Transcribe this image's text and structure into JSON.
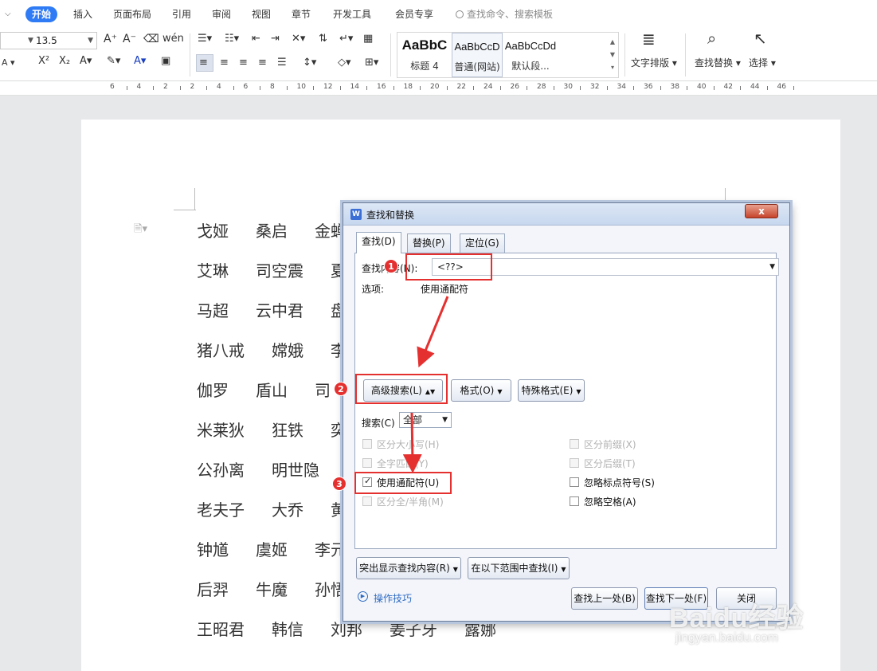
{
  "menubar": {
    "tabs": [
      "开始",
      "插入",
      "页面布局",
      "引用",
      "审阅",
      "视图",
      "章节",
      "开发工具",
      "会员专享"
    ],
    "search_placeholder": "查找命令、搜索模板"
  },
  "ribbon": {
    "font_size": "13.5",
    "styles": [
      {
        "sample": "AaBbC",
        "label": "标题 4"
      },
      {
        "sample": "AaBbCcD",
        "label": "普通(网站)"
      },
      {
        "sample": "AaBbCcDd",
        "label": "默认段..."
      }
    ],
    "text_layout_label": "文字排版",
    "find_replace_label": "查找替换",
    "select_label": "选择"
  },
  "ruler": {
    "labels": [
      "6",
      "4",
      "2",
      "2",
      "4",
      "6",
      "8",
      "10",
      "12",
      "14",
      "16",
      "18",
      "20",
      "22",
      "24",
      "26",
      "28",
      "30",
      "32",
      "34",
      "36",
      "38",
      "40",
      "42",
      "44",
      "46"
    ]
  },
  "document": {
    "rows": [
      [
        "戈娅",
        "桑启",
        "金蝉"
      ],
      [
        "艾琳",
        "司空震",
        "夏"
      ],
      [
        "马超",
        "云中君",
        "盘"
      ],
      [
        "猪八戒",
        "嫦娥",
        "李"
      ],
      [
        "伽罗",
        "盾山",
        "司"
      ],
      [
        "米莱狄",
        "狂铁",
        "奕"
      ],
      [
        "公孙离",
        "明世隐",
        ""
      ],
      [
        "老夫子",
        "大乔",
        "黄"
      ],
      [
        "钟馗",
        "虞姬",
        "李元"
      ],
      [
        "后羿",
        "牛魔",
        "孙悟"
      ],
      [
        "王昭君",
        "韩信",
        "刘邦",
        "姜子牙",
        "露娜"
      ]
    ]
  },
  "dialog": {
    "title": "查找和替换",
    "close_label": "x",
    "tabs": [
      "查找(D)",
      "替换(P)",
      "定位(G)"
    ],
    "find_label": "查找内容(N):",
    "find_value": "<??>",
    "options_label": "选项:",
    "options_value": "使用通配符",
    "advanced_button": "高级搜索(L)",
    "format_button": "格式(O)",
    "special_button": "特殊格式(E)",
    "search_label": "搜索(C)",
    "search_value": "全部",
    "checkboxes_left": [
      {
        "label": "区分大小写(H)",
        "checked": false,
        "disabled": true
      },
      {
        "label": "全字匹配(Y)",
        "checked": false,
        "disabled": true
      },
      {
        "label": "使用通配符(U)",
        "checked": true,
        "disabled": false
      },
      {
        "label": "区分全/半角(M)",
        "checked": false,
        "disabled": true
      }
    ],
    "checkboxes_right": [
      {
        "label": "区分前缀(X)",
        "checked": false,
        "disabled": true
      },
      {
        "label": "区分后缀(T)",
        "checked": false,
        "disabled": true
      },
      {
        "label": "忽略标点符号(S)",
        "checked": false,
        "disabled": false
      },
      {
        "label": "忽略空格(A)",
        "checked": false,
        "disabled": false
      }
    ],
    "highlight_button": "突出显示查找内容(R)",
    "scope_button": "在以下范围中查找(I)",
    "help_link": "操作技巧",
    "find_prev_button": "查找上一处(B)",
    "find_next_button": "查找下一处(F)",
    "close_button": "关闭"
  },
  "annotations": {
    "markers": [
      "1",
      "2",
      "3"
    ],
    "color": "#e53030"
  },
  "watermark": {
    "brand": "Baidu经验",
    "url": "jingyan.baidu.com"
  },
  "colors": {
    "accent": "#2f7bf5",
    "annotation_red": "#e53030",
    "link": "#2f6cc4"
  }
}
